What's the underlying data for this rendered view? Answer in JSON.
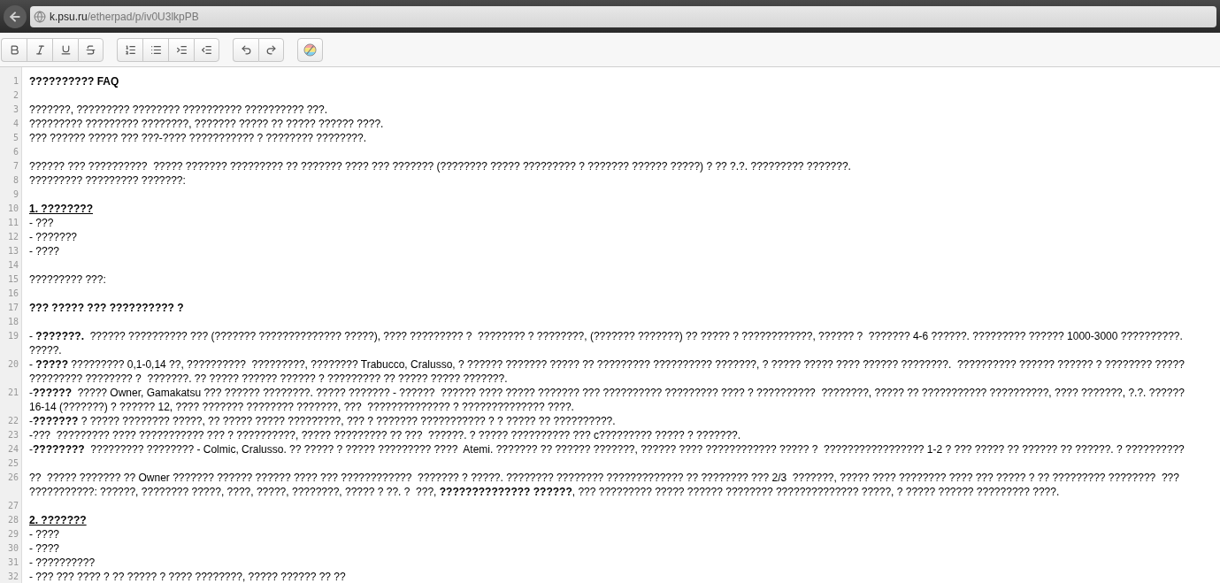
{
  "browser": {
    "url_host": "k.psu.ru",
    "url_path": "/etherpad/p/iv0U3lkpPB"
  },
  "lines": [
    {
      "number": "1",
      "kind": "bold",
      "rows": [
        "?????????? FAQ"
      ]
    },
    {
      "number": "2",
      "kind": "empty"
    },
    {
      "number": "3",
      "kind": "text",
      "rows": [
        "???????, ????????? ???????? ?????????? ?????????? ???."
      ]
    },
    {
      "number": "4",
      "kind": "text",
      "rows": [
        "????????? ????????? ????????, ??????? ????? ?? ????? ?????? ????."
      ]
    },
    {
      "number": "5",
      "kind": "text",
      "rows": [
        "??? ?????? ????? ??? ???-???? ??????????? ? ???????? ????????."
      ]
    },
    {
      "number": "6",
      "kind": "empty"
    },
    {
      "number": "7",
      "kind": "text",
      "rows": [
        "?????? ??? ??????????  ????? ??????? ????????? ?? ??????? ???? ??? ??????? (???????? ????? ????????? ? ??????? ?????? ?????) ? ?? ?.?. ????????? ???????."
      ]
    },
    {
      "number": "8",
      "kind": "text",
      "rows": [
        "????????? ????????? ???????:"
      ]
    },
    {
      "number": "9",
      "kind": "empty"
    },
    {
      "number": "10",
      "kind": "heading",
      "rows": [
        "1. ????????"
      ]
    },
    {
      "number": "11",
      "kind": "text",
      "rows": [
        "- ???"
      ]
    },
    {
      "number": "12",
      "kind": "text",
      "rows": [
        "- ???????"
      ]
    },
    {
      "number": "13",
      "kind": "text",
      "rows": [
        "- ????"
      ]
    },
    {
      "number": "14",
      "kind": "empty"
    },
    {
      "number": "15",
      "kind": "text",
      "rows": [
        "????????? ???:"
      ]
    },
    {
      "number": "16",
      "kind": "empty"
    },
    {
      "number": "17",
      "kind": "bold",
      "rows": [
        "??? ????? ??? ?????????? ?"
      ]
    },
    {
      "number": "18",
      "kind": "empty"
    },
    {
      "number": "19",
      "kind": "text",
      "rows": [
        "- **???????.**  ?????? ?????????? ??? (??????? ?????????????? ?????), ???? ????????? ?  ???????? ? ????????, (??????? ???????) ?? ????? ? ????????????, ?????? ?  ??????? 4-6 ??????. ????????? ?????? 1000-3000 ??????????.",
        "?????."
      ]
    },
    {
      "number": "20",
      "kind": "text",
      "rows": [
        "- **?????** ????????? 0,1-0,14 ??, ??????????  ?????????, ???????? Trabucco, Cralusso, ? ?????? ??????? ????? ?? ????????? ?????????? ???????, ? ????? ????? ???? ?????? ????????.  ?????????? ?????? ?????? ? ???????? ?????",
        "????????? ???????? ?  ???????. ?? ????? ?????? ?????? ? ????????? ?? ????? ????? ???????."
      ]
    },
    {
      "number": "21",
      "kind": "text",
      "rows": [
        "-**??????**  ????? Owner, Gamakatsu ??? ?????? ????????. ????? ??????? - ??????  ?????? ???? ????? ??????? ??? ?????????? ????????? ???? ? ??????????  ????????, ????? ?? ??????????? ??????????, ???? ???????, ?.?. ??????",
        "16-14 (???????) ? ?????? 12, ???? ??????? ???????? ???????, ???  ?????????????? ? ?????????????? ????."
      ]
    },
    {
      "number": "22",
      "kind": "text",
      "rows": [
        "-**???????** ? ????? ???????? ?????, ?? ????? ????? ?????????, ??? ? ??????? ??????????? ? ? ????? ?? ??????????."
      ]
    },
    {
      "number": "23",
      "kind": "text",
      "rows": [
        "-???  ????????? ???? ??????????? ??? ? ??????????, ????? ????????? ?? ???  ??????. ? ????? ?????????? ??? c????????? ????? ? ???????."
      ]
    },
    {
      "number": "24",
      "kind": "text",
      "rows": [
        "-**????????**  ????????? ???????? - Colmic, Cralusso. ?? ????? ? ????? ????????? ????  Atemi. ??????? ?? ?????? ???????, ?????? ???? ???????????? ????? ?  ????????????????? 1-2 ? ??? ????? ?? ?????? ?? ??????. ? ??????????"
      ]
    },
    {
      "number": "25",
      "kind": "empty"
    },
    {
      "number": "26",
      "kind": "text",
      "rows": [
        "??  ????? ??????? ?? Owner ??????? ?????? ?????? ???? ??? ????????????  ??????? ? ?????. ???????? ???????? ????????????? ?? ???????? ??? 2/3  ???????, ????? ???? ???????? ???? ??? ????? ? ?? ????????? ????????  ???",
        "???????????: ??????, ???????? ?????, ????, ?????, ????????, ????? ? ??. ?  ???, **?????????????? ??????**, ??? ????????? ????? ?????? ???????? ?????????????? ?????, ? ????? ?????? ????????? ????."
      ]
    },
    {
      "number": "27",
      "kind": "empty"
    },
    {
      "number": "28",
      "kind": "heading",
      "rows": [
        "2. ???????"
      ]
    },
    {
      "number": "29",
      "kind": "text",
      "rows": [
        "- ????"
      ]
    },
    {
      "number": "30",
      "kind": "text",
      "rows": [
        "- ????"
      ]
    },
    {
      "number": "31",
      "kind": "text",
      "rows": [
        "- ??????????"
      ]
    },
    {
      "number": "32",
      "kind": "text",
      "rows": [
        "- ??? ??? ???? ? ?? ????? ? ???? ????????, ????? ?????? ?? ??"
      ]
    }
  ]
}
